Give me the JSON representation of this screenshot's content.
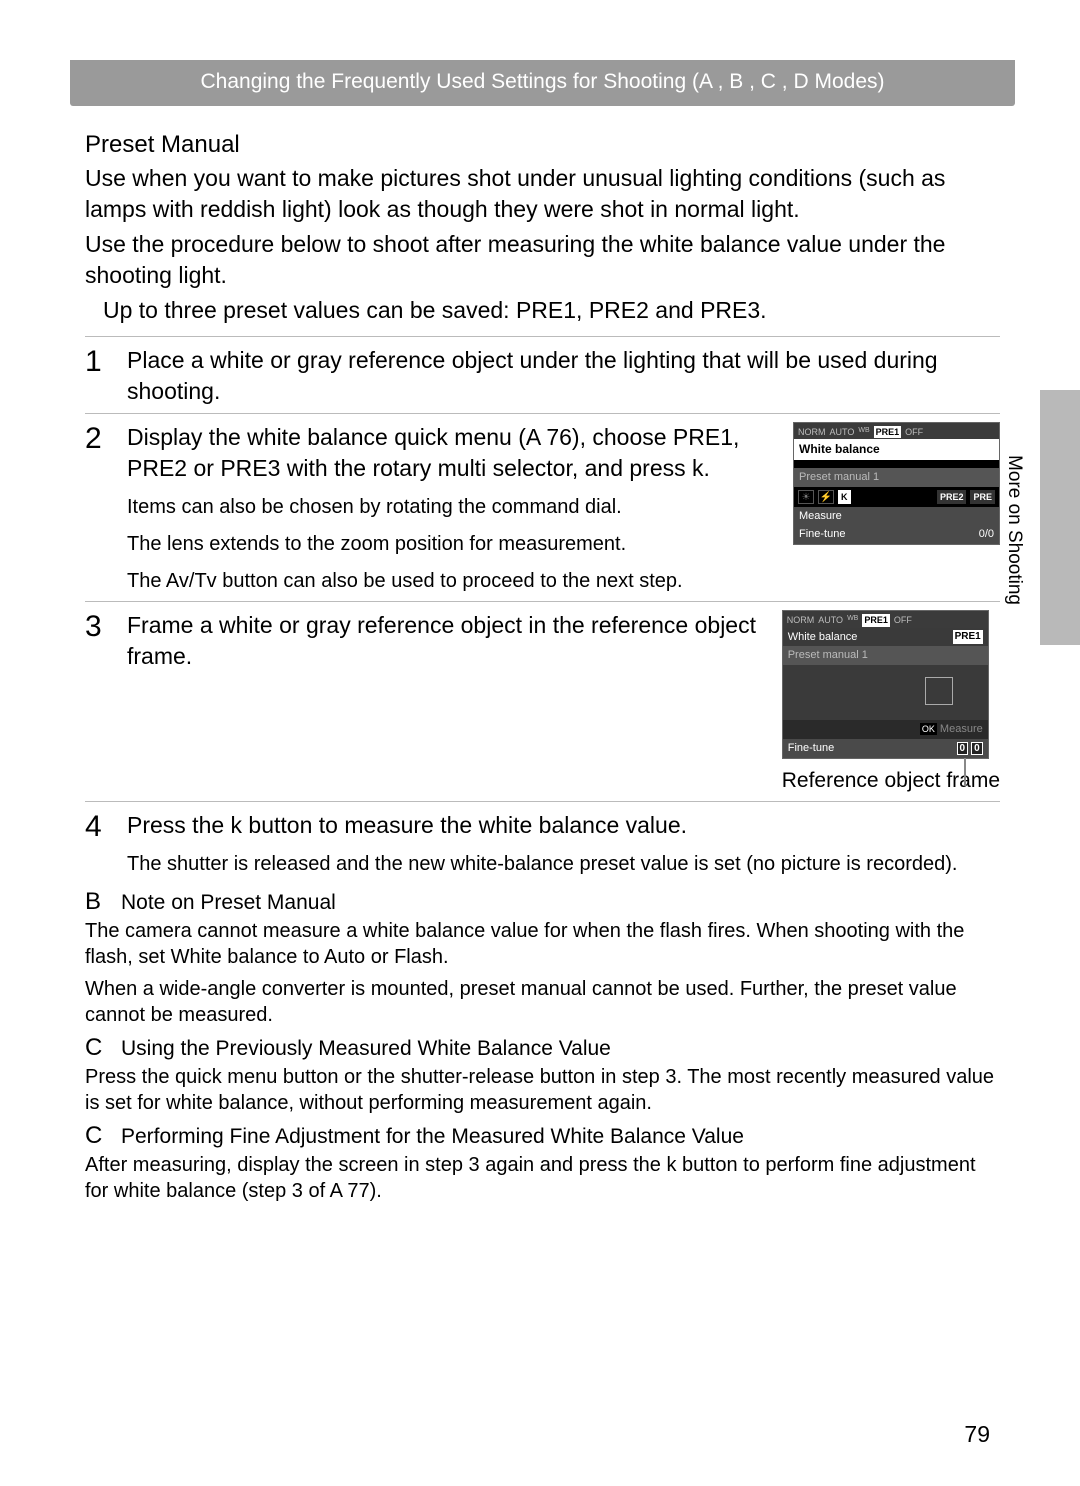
{
  "header": "Changing the Frequently Used Settings for Shooting (A , B , C , D  Modes)",
  "side_label": "More on Shooting",
  "page_number": "79",
  "section": {
    "title": "Preset Manual",
    "para1": "Use when you want to make pictures shot under unusual lighting conditions (such as lamps with reddish light) look as though they were shot in normal light.",
    "para2": "Use the procedure below to shoot after measuring the white balance value under the shooting light.",
    "bullet": "Up to three preset values can be saved: PRE1, PRE2 and PRE3."
  },
  "steps": [
    {
      "num": "1",
      "text": "Place a white or gray reference object under the lighting that will be used during shooting."
    },
    {
      "num": "2",
      "text": "Display the white balance quick menu (A  76), choose PRE1, PRE2 or PRE3 with the rotary multi selector, and press k.",
      "sub1": "Items can also be chosen by rotating the command dial.",
      "sub2": "The lens extends to the zoom position for measurement.",
      "sub3": "The Av/Tv button can also be used to proceed to the next step."
    },
    {
      "num": "3",
      "text": "Frame a white or gray reference object in the reference object frame.",
      "caption": "Reference object frame"
    },
    {
      "num": "4",
      "text": "Press the k button to measure the white balance value.",
      "sub1": "The shutter is released and the new white-balance preset value is set (no picture is recorded)."
    }
  ],
  "lcd1": {
    "top": {
      "norm": "NORM",
      "auto": "AUTO",
      "wb": "WB",
      "pre1": "PRE1",
      "off": "OFF"
    },
    "title": "White balance",
    "preset_row": "Preset manual 1",
    "icons": {
      "k": "K",
      "pre2": "PRE2",
      "pre3": "PRE"
    },
    "measure": "Measure",
    "finetune": "Fine-tune",
    "value": "0/0"
  },
  "lcd2": {
    "top": {
      "norm": "NORM",
      "auto": "AUTO",
      "wb": "WB",
      "pre1": "PRE1",
      "off": "OFF"
    },
    "title": "White balance",
    "badge": "PRE1",
    "preset_row": "Preset manual 1",
    "ok": "OK",
    "measure": "Measure",
    "finetune": "Fine-tune",
    "v1": "0",
    "v2": "0"
  },
  "notes": {
    "n1_icon": "B",
    "n1_title": "Note on Preset Manual",
    "n1_body1": "The camera cannot measure a white balance value for when the flash fires. When shooting with the flash, set White balance to Auto or Flash.",
    "n1_body2": "When a wide-angle converter is mounted, preset manual cannot be used. Further, the preset value cannot be measured.",
    "n2_icon": "C",
    "n2_title": "Using the Previously Measured White Balance Value",
    "n2_body": "Press the quick menu button or the shutter-release button in step 3. The most recently measured value is set for white balance, without performing measurement again.",
    "n3_icon": "C",
    "n3_title": "Performing Fine Adjustment for the Measured White Balance Value",
    "n3_body": "After measuring, display the screen in step 3 again and press the k button to perform fine adjustment for white balance (step 3 of A 77)."
  }
}
